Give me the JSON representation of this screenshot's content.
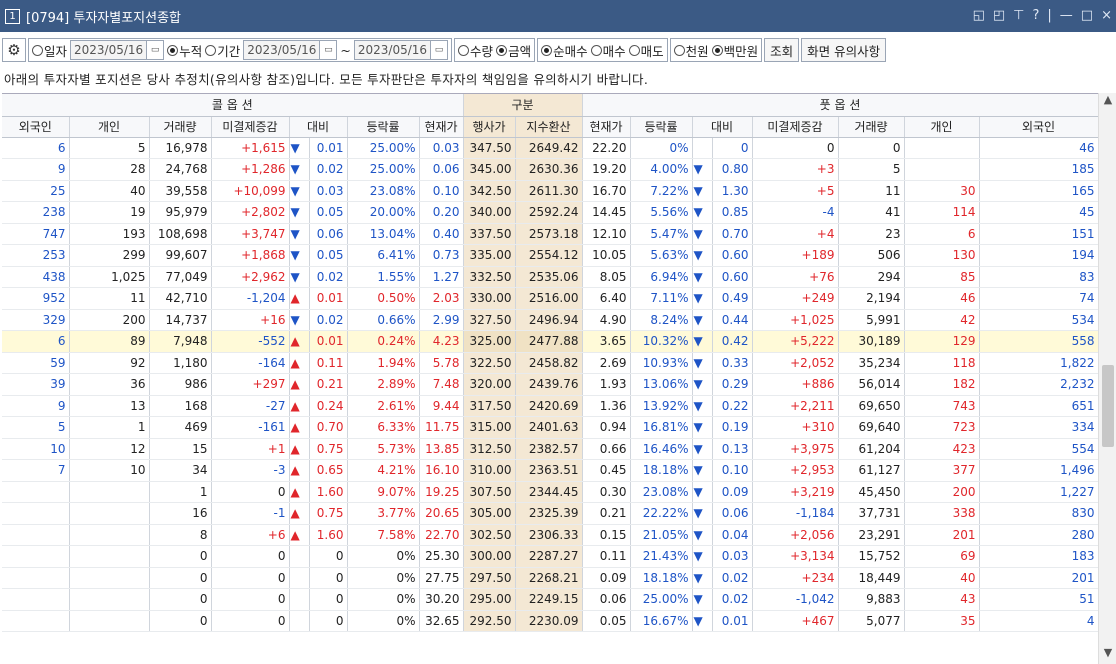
{
  "window": {
    "number": "1",
    "title": "[0794] 투자자별포지션종합",
    "controls": [
      "◱",
      "◰",
      "⊤",
      "?",
      "|",
      "—",
      "□",
      "×"
    ]
  },
  "toolbar": {
    "date_opt": "일자",
    "date1": "2023/05/16",
    "cum_opt": "누적",
    "period_opt": "기간",
    "date2": "2023/05/16",
    "sep": "~",
    "date3": "2023/05/16",
    "qty_opt": "수량",
    "amt_opt": "금액",
    "net_opt": "순매수",
    "buy_opt": "매수",
    "sell_opt": "매도",
    "won_opt": "천원",
    "mil_opt": "백만원",
    "query_btn": "조회",
    "notes_btn": "화면 유의사항"
  },
  "notice": "아래의 투자자별 포지션은 당사 추정치(유의사항 참조)입니다. 모든 투자판단은 투자자의 책임임을 유의하시기 바랍니다.",
  "headers": {
    "call": "콜 옵 션",
    "mid": "구분",
    "put": "풋 옵 션",
    "cols": [
      "외국인",
      "개인",
      "거래량",
      "미결제증감",
      "대비",
      "등락률",
      "현재가",
      "행사가",
      "지수환산",
      "현재가",
      "등락률",
      "대비",
      "미결제증감",
      "거래량",
      "개인",
      "외국인"
    ]
  },
  "colors": {
    "up": "#e0262b",
    "down": "#1e54c6",
    "mid_bg": "#f4e8d4",
    "highlight_row": "#fffad8"
  },
  "rows": [
    [
      "6",
      "5",
      "16,978",
      "+1,615",
      "▼",
      "0.01",
      "25.00%",
      "0.03",
      "347.50",
      "2649.42",
      "22.20",
      "0%",
      "",
      "0",
      "0",
      "0",
      "",
      "46",
      ""
    ],
    [
      "9",
      "28",
      "24,768",
      "+1,286",
      "▼",
      "0.02",
      "25.00%",
      "0.06",
      "345.00",
      "2630.36",
      "19.20",
      "4.00%",
      "▼",
      "0.80",
      "+3",
      "5",
      "",
      "185"
    ],
    [
      "25",
      "40",
      "39,558",
      "+10,099",
      "▼",
      "0.03",
      "23.08%",
      "0.10",
      "342.50",
      "2611.30",
      "16.70",
      "7.22%",
      "▼",
      "1.30",
      "+5",
      "11",
      "30",
      "165"
    ],
    [
      "238",
      "19",
      "95,979",
      "+2,802",
      "▼",
      "0.05",
      "20.00%",
      "0.20",
      "340.00",
      "2592.24",
      "14.45",
      "5.56%",
      "▼",
      "0.85",
      "-4",
      "41",
      "114",
      "45"
    ],
    [
      "747",
      "193",
      "108,698",
      "+3,747",
      "▼",
      "0.06",
      "13.04%",
      "0.40",
      "337.50",
      "2573.18",
      "12.10",
      "5.47%",
      "▼",
      "0.70",
      "+4",
      "23",
      "6",
      "151"
    ],
    [
      "253",
      "299",
      "99,607",
      "+1,868",
      "▼",
      "0.05",
      "6.41%",
      "0.73",
      "335.00",
      "2554.12",
      "10.05",
      "5.63%",
      "▼",
      "0.60",
      "+189",
      "506",
      "130",
      "194"
    ],
    [
      "438",
      "1,025",
      "77,049",
      "+2,962",
      "▼",
      "0.02",
      "1.55%",
      "1.27",
      "332.50",
      "2535.06",
      "8.05",
      "6.94%",
      "▼",
      "0.60",
      "+76",
      "294",
      "85",
      "83"
    ],
    [
      "952",
      "11",
      "42,710",
      "-1,204",
      "▲",
      "0.01",
      "0.50%",
      "2.03",
      "330.00",
      "2516.00",
      "6.40",
      "7.11%",
      "▼",
      "0.49",
      "+249",
      "2,194",
      "46",
      "74"
    ],
    [
      "329",
      "200",
      "14,737",
      "+16",
      "▼",
      "0.02",
      "0.66%",
      "2.99",
      "327.50",
      "2496.94",
      "4.90",
      "8.24%",
      "▼",
      "0.44",
      "+1,025",
      "5,991",
      "42",
      "534"
    ],
    [
      "6",
      "89",
      "7,948",
      "-552",
      "▲",
      "0.01",
      "0.24%",
      "4.23",
      "325.00",
      "2477.88",
      "3.65",
      "10.32%",
      "▼",
      "0.42",
      "+5,222",
      "30,189",
      "129",
      "558"
    ],
    [
      "59",
      "92",
      "1,180",
      "-164",
      "▲",
      "0.11",
      "1.94%",
      "5.78",
      "322.50",
      "2458.82",
      "2.69",
      "10.93%",
      "▼",
      "0.33",
      "+2,052",
      "35,234",
      "118",
      "1,822"
    ],
    [
      "39",
      "36",
      "986",
      "+297",
      "▲",
      "0.21",
      "2.89%",
      "7.48",
      "320.00",
      "2439.76",
      "1.93",
      "13.06%",
      "▼",
      "0.29",
      "+886",
      "56,014",
      "182",
      "2,232"
    ],
    [
      "9",
      "13",
      "168",
      "-27",
      "▲",
      "0.24",
      "2.61%",
      "9.44",
      "317.50",
      "2420.69",
      "1.36",
      "13.92%",
      "▼",
      "0.22",
      "+2,211",
      "69,650",
      "743",
      "651"
    ],
    [
      "5",
      "1",
      "469",
      "-161",
      "▲",
      "0.70",
      "6.33%",
      "11.75",
      "315.00",
      "2401.63",
      "0.94",
      "16.81%",
      "▼",
      "0.19",
      "+310",
      "69,640",
      "723",
      "334"
    ],
    [
      "10",
      "12",
      "15",
      "+1",
      "▲",
      "0.75",
      "5.73%",
      "13.85",
      "312.50",
      "2382.57",
      "0.66",
      "16.46%",
      "▼",
      "0.13",
      "+3,975",
      "61,204",
      "423",
      "554"
    ],
    [
      "7",
      "10",
      "34",
      "-3",
      "▲",
      "0.65",
      "4.21%",
      "16.10",
      "310.00",
      "2363.51",
      "0.45",
      "18.18%",
      "▼",
      "0.10",
      "+2,953",
      "61,127",
      "377",
      "1,496"
    ],
    [
      "",
      "",
      "1",
      "0",
      "▲",
      "1.60",
      "9.07%",
      "19.25",
      "307.50",
      "2344.45",
      "0.30",
      "23.08%",
      "▼",
      "0.09",
      "+3,219",
      "45,450",
      "200",
      "1,227"
    ],
    [
      "",
      "",
      "16",
      "-1",
      "▲",
      "0.75",
      "3.77%",
      "20.65",
      "305.00",
      "2325.39",
      "0.21",
      "22.22%",
      "▼",
      "0.06",
      "-1,184",
      "37,731",
      "338",
      "830"
    ],
    [
      "",
      "",
      "8",
      "+6",
      "▲",
      "1.60",
      "7.58%",
      "22.70",
      "302.50",
      "2306.33",
      "0.15",
      "21.05%",
      "▼",
      "0.04",
      "+2,056",
      "23,291",
      "201",
      "280"
    ],
    [
      "",
      "",
      "0",
      "0",
      "",
      "0",
      "0%",
      "25.30",
      "300.00",
      "2287.27",
      "0.11",
      "21.43%",
      "▼",
      "0.03",
      "+3,134",
      "15,752",
      "69",
      "183"
    ],
    [
      "",
      "",
      "0",
      "0",
      "",
      "0",
      "0%",
      "27.75",
      "297.50",
      "2268.21",
      "0.09",
      "18.18%",
      "▼",
      "0.02",
      "+234",
      "18,449",
      "40",
      "201"
    ],
    [
      "",
      "",
      "0",
      "0",
      "",
      "0",
      "0%",
      "30.20",
      "295.00",
      "2249.15",
      "0.06",
      "25.00%",
      "▼",
      "0.02",
      "-1,042",
      "9,883",
      "43",
      "51"
    ],
    [
      "",
      "",
      "0",
      "0",
      "",
      "0",
      "0%",
      "32.65",
      "292.50",
      "2230.09",
      "0.05",
      "16.67%",
      "▼",
      "0.01",
      "+467",
      "5,077",
      "35",
      "4"
    ]
  ]
}
